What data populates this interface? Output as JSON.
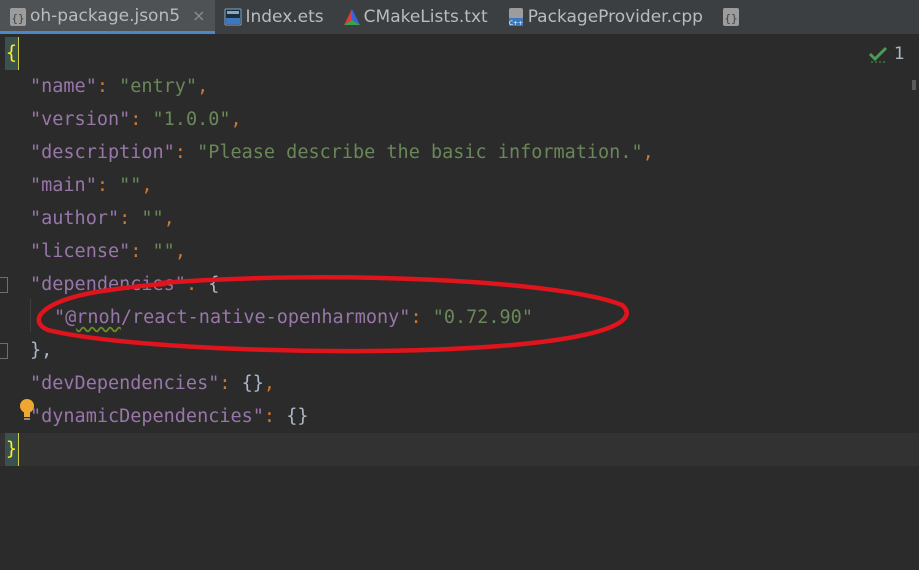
{
  "tabs": [
    {
      "label": "oh-package.json5",
      "active": true,
      "icon": "json5-file-icon"
    },
    {
      "label": "Index.ets",
      "active": false,
      "icon": "ets-file-icon"
    },
    {
      "label": "CMakeLists.txt",
      "active": false,
      "icon": "cmake-file-icon"
    },
    {
      "label": "PackageProvider.cpp",
      "active": false,
      "icon": "cpp-file-icon"
    }
  ],
  "close_glyph": "×",
  "inspection": {
    "count": "1",
    "icon": "check-inspection-icon"
  },
  "code": {
    "open_brace": "{",
    "close_brace": "}",
    "name_key": "\"name\"",
    "name_val": "\"entry\"",
    "version_key": "\"version\"",
    "version_val": "\"1.0.0\"",
    "description_key": "\"description\"",
    "description_val": "\"Please describe the basic information.\"",
    "main_key": "\"main\"",
    "main_val": "\"\"",
    "author_key": "\"author\"",
    "author_val": "\"\"",
    "license_key": "\"license\"",
    "license_val": "\"\"",
    "dependencies_key": "\"dependencies\"",
    "dep_key_prefix": "\"@",
    "dep_key_scope": "rnoh",
    "dep_key_rest": "/react-native-openharmony\"",
    "dep_val": "\"0.72.90\"",
    "devDependencies_key": "\"devDependencies\"",
    "dynamicDependencies_key": "\"dynamicDependencies\"",
    "empty_obj": "{}",
    "colon": ": ",
    "comma": ",",
    "close_obj_comma": "},",
    "open_obj": "{"
  },
  "colors": {
    "key": "#9876aa",
    "string": "#6a8759",
    "punctuation": "#cc7832",
    "annotation": "#e0141c",
    "tab_active_underline": "#4a88c7"
  }
}
